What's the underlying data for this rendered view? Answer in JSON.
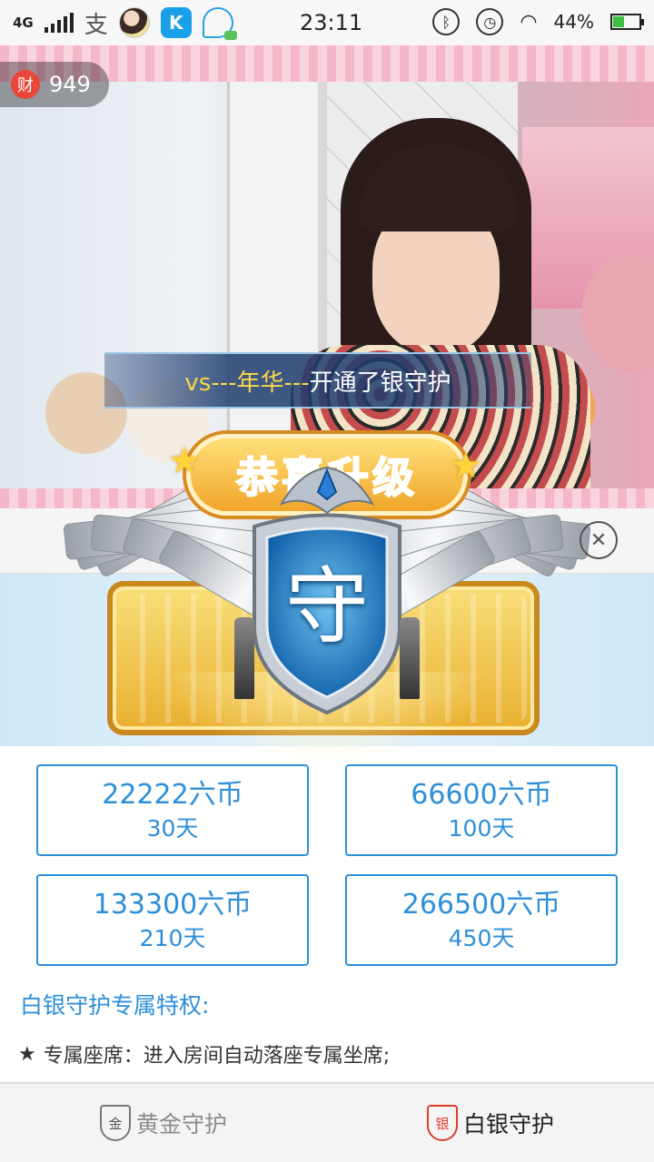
{
  "status_bar": {
    "network": "4G",
    "app_glyph": "支",
    "time": "23:11",
    "battery_percent": "44%",
    "battery_level": 0.44,
    "alarm_icon": "alarm-icon",
    "bluetooth_icon": "bluetooth-icon",
    "wifi_icon": "wifi-icon"
  },
  "wealth_badge": {
    "icon_text": "财",
    "value": "949"
  },
  "announcement": {
    "user": "vs---年华---",
    "message": "开通了银守护"
  },
  "upgrade_badge": {
    "title": "恭喜升级",
    "shield_char": "守"
  },
  "plans": [
    {
      "price": "22222六币",
      "days": "30天"
    },
    {
      "price": "66600六币",
      "days": "100天"
    },
    {
      "price": "133300六币",
      "days": "210天"
    },
    {
      "price": "266500六币",
      "days": "450天"
    }
  ],
  "privileges": {
    "title": "白银守护专属特权:",
    "items": [
      {
        "star": "★",
        "text": "专属座席：进入房间自动落座专属坐席;"
      }
    ]
  },
  "tabs": [
    {
      "icon_text": "金",
      "label": "黄金守护",
      "active": false
    },
    {
      "icon_text": "银",
      "label": "白银守护",
      "active": true
    }
  ],
  "colors": {
    "accent_blue": "#2e8fd9",
    "active_red": "#e03c2a",
    "gold": "#f0a52a"
  }
}
